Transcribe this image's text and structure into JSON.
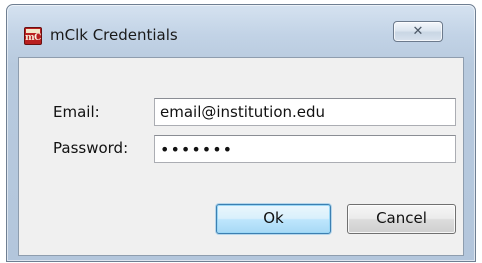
{
  "window": {
    "title": "mClk Credentials",
    "app_icon_text": "mC",
    "close_glyph": "✕"
  },
  "form": {
    "email_label": "Email:",
    "email_value": "email@institution.edu",
    "password_label": "Password:",
    "password_value": "•••••••"
  },
  "buttons": {
    "ok_label": "Ok",
    "cancel_label": "Cancel"
  },
  "colors": {
    "title_bar": "#c2d3e6",
    "client_bg": "#f0f0f0",
    "default_button_border": "#3c7fb1"
  },
  "icons": {
    "app": "mclk-app-icon",
    "close": "close-icon"
  }
}
